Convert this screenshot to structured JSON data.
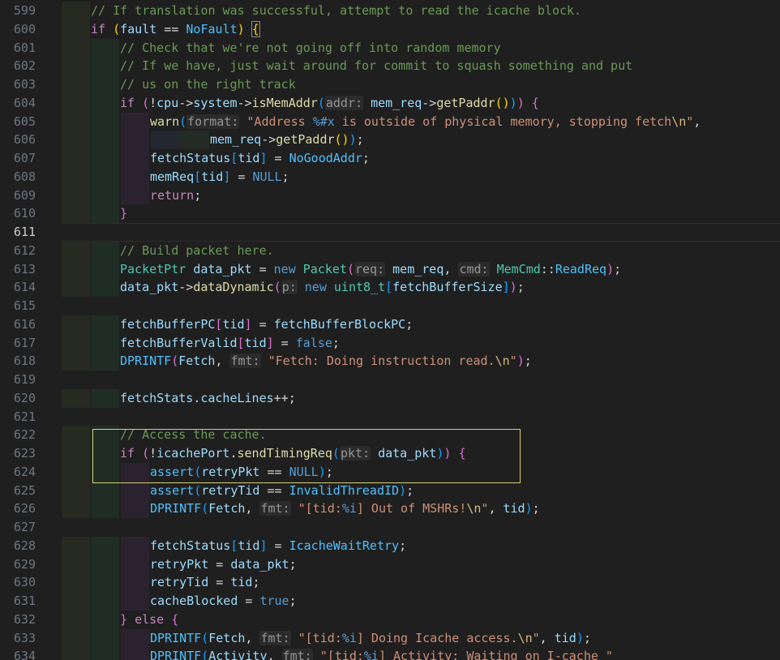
{
  "editor": {
    "current_line": 611,
    "lines": [
      {
        "n": 599,
        "indent": 1,
        "tokens": [
          [
            "cmt",
            "// If translation was successful, attempt to read the icache block."
          ]
        ]
      },
      {
        "n": 600,
        "indent": 1,
        "tokens": [
          [
            "kw",
            "if"
          ],
          [
            "op",
            " "
          ],
          [
            "b1",
            "("
          ],
          [
            "var",
            "fault"
          ],
          [
            "op",
            " == "
          ],
          [
            "con",
            "NoFault"
          ],
          [
            "b1",
            ")"
          ],
          [
            "op",
            " "
          ],
          [
            "bm b1",
            "{"
          ]
        ]
      },
      {
        "n": 601,
        "indent": 2,
        "tokens": [
          [
            "cmt",
            "// Check that we're not going off into random memory"
          ]
        ]
      },
      {
        "n": 602,
        "indent": 2,
        "tokens": [
          [
            "cmt",
            "// If we have, just wait around for commit to squash something and put"
          ]
        ]
      },
      {
        "n": 603,
        "indent": 2,
        "tokens": [
          [
            "cmt",
            "// us on the right track"
          ]
        ]
      },
      {
        "n": 604,
        "indent": 2,
        "tokens": [
          [
            "kw",
            "if"
          ],
          [
            "op",
            " "
          ],
          [
            "b2",
            "("
          ],
          [
            "op",
            "!"
          ],
          [
            "var",
            "cpu"
          ],
          [
            "op",
            "->"
          ],
          [
            "var",
            "system"
          ],
          [
            "op",
            "->"
          ],
          [
            "fn",
            "isMemAddr"
          ],
          [
            "b3",
            "("
          ],
          [
            "hint",
            "addr:"
          ],
          [
            "op",
            " "
          ],
          [
            "var",
            "mem_req"
          ],
          [
            "op",
            "->"
          ],
          [
            "fn",
            "getPaddr"
          ],
          [
            "b1",
            "()"
          ],
          [
            "b3",
            ")"
          ],
          [
            "b2",
            ")"
          ],
          [
            "op",
            " "
          ],
          [
            "b2",
            "{"
          ]
        ]
      },
      {
        "n": 605,
        "indent": 3,
        "tokens": [
          [
            "fn",
            "warn"
          ],
          [
            "b3",
            "("
          ],
          [
            "hint",
            "format:"
          ],
          [
            "op",
            " "
          ],
          [
            "str",
            "\"Address "
          ],
          [
            "kwb",
            "%#x"
          ],
          [
            "str",
            " is outside of physical memory, stopping fetch"
          ],
          [
            "esc",
            "\\n"
          ],
          [
            "str",
            "\""
          ],
          [
            "op",
            ","
          ]
        ]
      },
      {
        "n": 606,
        "indent": 5,
        "tokens": [
          [
            "var",
            "mem_req"
          ],
          [
            "op",
            "->"
          ],
          [
            "fn",
            "getPaddr"
          ],
          [
            "b1",
            "()"
          ],
          [
            "b3",
            ")"
          ],
          [
            "op",
            ";"
          ]
        ]
      },
      {
        "n": 607,
        "indent": 3,
        "tokens": [
          [
            "var",
            "fetchStatus"
          ],
          [
            "b3",
            "["
          ],
          [
            "var",
            "tid"
          ],
          [
            "b3",
            "]"
          ],
          [
            "op",
            " = "
          ],
          [
            "con",
            "NoGoodAddr"
          ],
          [
            "op",
            ";"
          ]
        ]
      },
      {
        "n": 608,
        "indent": 3,
        "tokens": [
          [
            "var",
            "memReq"
          ],
          [
            "b3",
            "["
          ],
          [
            "var",
            "tid"
          ],
          [
            "b3",
            "]"
          ],
          [
            "op",
            " = "
          ],
          [
            "kwb",
            "NULL"
          ],
          [
            "op",
            ";"
          ]
        ]
      },
      {
        "n": 609,
        "indent": 3,
        "tokens": [
          [
            "kw",
            "return"
          ],
          [
            "op",
            ";"
          ]
        ]
      },
      {
        "n": 610,
        "indent": 2,
        "tokens": [
          [
            "b2",
            "}"
          ]
        ]
      },
      {
        "n": 611,
        "indent": 0,
        "tokens": []
      },
      {
        "n": 612,
        "indent": 2,
        "tokens": [
          [
            "cmt",
            "// Build packet here."
          ]
        ]
      },
      {
        "n": 613,
        "indent": 2,
        "tokens": [
          [
            "typ",
            "PacketPtr"
          ],
          [
            "op",
            " "
          ],
          [
            "var",
            "data_pkt"
          ],
          [
            "op",
            " = "
          ],
          [
            "kwb",
            "new"
          ],
          [
            "op",
            " "
          ],
          [
            "typ",
            "Packet"
          ],
          [
            "b2",
            "("
          ],
          [
            "hint",
            "req:"
          ],
          [
            "op",
            " "
          ],
          [
            "var",
            "mem_req"
          ],
          [
            "op",
            ", "
          ],
          [
            "hint",
            "cmd:"
          ],
          [
            "op",
            " "
          ],
          [
            "typ",
            "MemCmd"
          ],
          [
            "op",
            "::"
          ],
          [
            "con",
            "ReadReq"
          ],
          [
            "b2",
            ")"
          ],
          [
            "op",
            ";"
          ]
        ]
      },
      {
        "n": 614,
        "indent": 2,
        "tokens": [
          [
            "var",
            "data_pkt"
          ],
          [
            "op",
            "->"
          ],
          [
            "fn",
            "dataDynamic"
          ],
          [
            "b2",
            "("
          ],
          [
            "hint",
            "p:"
          ],
          [
            "op",
            " "
          ],
          [
            "kwb",
            "new"
          ],
          [
            "op",
            " "
          ],
          [
            "typ",
            "uint8_t"
          ],
          [
            "b3",
            "["
          ],
          [
            "var",
            "fetchBufferSize"
          ],
          [
            "b3",
            "]"
          ],
          [
            "b2",
            ")"
          ],
          [
            "op",
            ";"
          ]
        ]
      },
      {
        "n": 615,
        "indent": 0,
        "tokens": []
      },
      {
        "n": 616,
        "indent": 2,
        "tokens": [
          [
            "var",
            "fetchBufferPC"
          ],
          [
            "b2",
            "["
          ],
          [
            "var",
            "tid"
          ],
          [
            "b2",
            "]"
          ],
          [
            "op",
            " = "
          ],
          [
            "var",
            "fetchBufferBlockPC"
          ],
          [
            "op",
            ";"
          ]
        ]
      },
      {
        "n": 617,
        "indent": 2,
        "tokens": [
          [
            "var",
            "fetchBufferValid"
          ],
          [
            "b2",
            "["
          ],
          [
            "var",
            "tid"
          ],
          [
            "b2",
            "]"
          ],
          [
            "op",
            " = "
          ],
          [
            "kwb",
            "false"
          ],
          [
            "op",
            ";"
          ]
        ]
      },
      {
        "n": 618,
        "indent": 2,
        "tokens": [
          [
            "con",
            "DPRINTF"
          ],
          [
            "b2",
            "("
          ],
          [
            "var",
            "Fetch"
          ],
          [
            "op",
            ", "
          ],
          [
            "hint",
            "fmt:"
          ],
          [
            "op",
            " "
          ],
          [
            "str",
            "\"Fetch: Doing instruction read."
          ],
          [
            "esc",
            "\\n"
          ],
          [
            "str",
            "\""
          ],
          [
            "b2",
            ")"
          ],
          [
            "op",
            ";"
          ]
        ]
      },
      {
        "n": 619,
        "indent": 0,
        "tokens": []
      },
      {
        "n": 620,
        "indent": 2,
        "tokens": [
          [
            "var",
            "fetchStats"
          ],
          [
            "op",
            "."
          ],
          [
            "var",
            "cacheLines"
          ],
          [
            "op",
            "++;"
          ]
        ]
      },
      {
        "n": 621,
        "indent": 0,
        "tokens": []
      },
      {
        "n": 622,
        "indent": 2,
        "tokens": [
          [
            "cmt",
            "// Access the cache."
          ]
        ]
      },
      {
        "n": 623,
        "indent": 2,
        "tokens": [
          [
            "kw",
            "if"
          ],
          [
            "op",
            " "
          ],
          [
            "b2",
            "("
          ],
          [
            "op",
            "!"
          ],
          [
            "var",
            "icachePort"
          ],
          [
            "op",
            "."
          ],
          [
            "fn",
            "sendTimingReq"
          ],
          [
            "b3",
            "("
          ],
          [
            "hint",
            "pkt:"
          ],
          [
            "op",
            " "
          ],
          [
            "var",
            "data_pkt"
          ],
          [
            "b3",
            ")"
          ],
          [
            "b2",
            ")"
          ],
          [
            "op",
            " "
          ],
          [
            "b2",
            "{"
          ]
        ]
      },
      {
        "n": 624,
        "indent": 3,
        "tokens": [
          [
            "con",
            "assert"
          ],
          [
            "b3",
            "("
          ],
          [
            "var",
            "retryPkt"
          ],
          [
            "op",
            " == "
          ],
          [
            "kwb",
            "NULL"
          ],
          [
            "b3",
            ")"
          ],
          [
            "op",
            ";"
          ]
        ]
      },
      {
        "n": 625,
        "indent": 3,
        "tokens": [
          [
            "con",
            "assert"
          ],
          [
            "b3",
            "("
          ],
          [
            "var",
            "retryTid"
          ],
          [
            "op",
            " == "
          ],
          [
            "con",
            "InvalidThreadID"
          ],
          [
            "b3",
            ")"
          ],
          [
            "op",
            ";"
          ]
        ]
      },
      {
        "n": 626,
        "indent": 3,
        "tokens": [
          [
            "con",
            "DPRINTF"
          ],
          [
            "b3",
            "("
          ],
          [
            "var",
            "Fetch"
          ],
          [
            "op",
            ", "
          ],
          [
            "hint",
            "fmt:"
          ],
          [
            "op",
            " "
          ],
          [
            "str",
            "\"[tid:"
          ],
          [
            "kwb",
            "%i"
          ],
          [
            "str",
            "] Out of MSHRs!"
          ],
          [
            "esc",
            "\\n"
          ],
          [
            "str",
            "\""
          ],
          [
            "op",
            ", "
          ],
          [
            "var",
            "tid"
          ],
          [
            "b3",
            ")"
          ],
          [
            "op",
            ";"
          ]
        ]
      },
      {
        "n": 627,
        "indent": 0,
        "tokens": []
      },
      {
        "n": 628,
        "indent": 3,
        "tokens": [
          [
            "var",
            "fetchStatus"
          ],
          [
            "b3",
            "["
          ],
          [
            "var",
            "tid"
          ],
          [
            "b3",
            "]"
          ],
          [
            "op",
            " = "
          ],
          [
            "con",
            "IcacheWaitRetry"
          ],
          [
            "op",
            ";"
          ]
        ]
      },
      {
        "n": 629,
        "indent": 3,
        "tokens": [
          [
            "var",
            "retryPkt"
          ],
          [
            "op",
            " = "
          ],
          [
            "var",
            "data_pkt"
          ],
          [
            "op",
            ";"
          ]
        ]
      },
      {
        "n": 630,
        "indent": 3,
        "tokens": [
          [
            "var",
            "retryTid"
          ],
          [
            "op",
            " = "
          ],
          [
            "var",
            "tid"
          ],
          [
            "op",
            ";"
          ]
        ]
      },
      {
        "n": 631,
        "indent": 3,
        "tokens": [
          [
            "var",
            "cacheBlocked"
          ],
          [
            "op",
            " = "
          ],
          [
            "kwb",
            "true"
          ],
          [
            "op",
            ";"
          ]
        ]
      },
      {
        "n": 632,
        "indent": 2,
        "tokens": [
          [
            "b2",
            "}"
          ],
          [
            "op",
            " "
          ],
          [
            "kw",
            "else"
          ],
          [
            "op",
            " "
          ],
          [
            "b2",
            "{"
          ]
        ]
      },
      {
        "n": 633,
        "indent": 3,
        "tokens": [
          [
            "con",
            "DPRINTF"
          ],
          [
            "b3",
            "("
          ],
          [
            "var",
            "Fetch"
          ],
          [
            "op",
            ", "
          ],
          [
            "hint",
            "fmt:"
          ],
          [
            "op",
            " "
          ],
          [
            "str",
            "\"[tid:"
          ],
          [
            "kwb",
            "%i"
          ],
          [
            "str",
            "] Doing Icache access."
          ],
          [
            "esc",
            "\\n"
          ],
          [
            "str",
            "\""
          ],
          [
            "op",
            ", "
          ],
          [
            "var",
            "tid"
          ],
          [
            "b3",
            ")"
          ],
          [
            "op",
            ";"
          ]
        ]
      },
      {
        "n": 634,
        "indent": 3,
        "tokens": [
          [
            "con",
            "DPRINTF"
          ],
          [
            "b3",
            "("
          ],
          [
            "var",
            "Activity"
          ],
          [
            "op",
            ", "
          ],
          [
            "hint",
            "fmt:"
          ],
          [
            "op",
            " "
          ],
          [
            "str",
            "\"[tid:"
          ],
          [
            "kwb",
            "%i"
          ],
          [
            "str",
            "] Activity: Waiting on I-cache \""
          ]
        ]
      }
    ]
  }
}
